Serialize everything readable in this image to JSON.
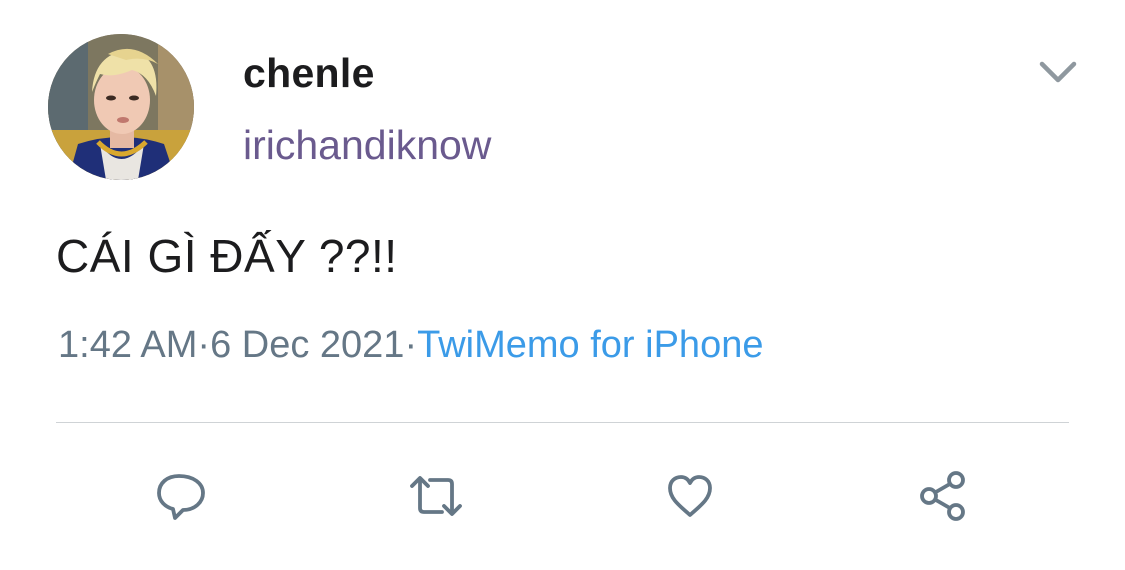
{
  "tweet": {
    "display_name": "chenle",
    "handle": "irichandiknow",
    "text": "CÁI GÌ ĐẤY ??!!",
    "time": "1:42 AM",
    "separator": "·",
    "date": "6 Dec 2021",
    "source": "TwiMemo for iPhone"
  },
  "icons": {
    "menu": "chevron-down-icon",
    "reply": "reply-icon",
    "retweet": "retweet-icon",
    "like": "heart-icon",
    "share": "share-icon"
  },
  "colors": {
    "name": "#1c1c1e",
    "handle": "#6a5a8e",
    "meta": "#657786",
    "source_link": "#3b9be8",
    "icon": "#657786",
    "divider": "#cfd3d6"
  }
}
